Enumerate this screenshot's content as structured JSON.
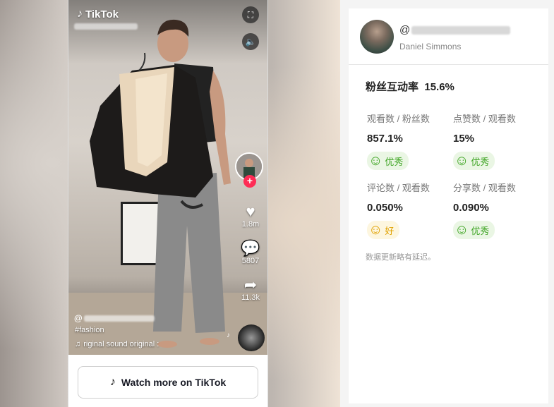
{
  "tiktok": {
    "brand": "TikTok",
    "likes": "1.8m",
    "comments": "5807",
    "shares": "11.3k",
    "handle_prefix": "@",
    "hashtag": "#fashion",
    "sound": "riginal sound   original :",
    "watch_button": "Watch more on TikTok"
  },
  "panel": {
    "at_prefix": "@",
    "name": "Daniel Simmons",
    "engagement_label": "粉丝互动率",
    "engagement_value": "15.6%",
    "metrics": [
      {
        "label": "观看数 / 粉丝数",
        "value": "857.1%",
        "rating": "优秀"
      },
      {
        "label": "点赞数 / 观看数",
        "value": "15%",
        "rating": "优秀"
      },
      {
        "label": "评论数 / 观看数",
        "value": "0.050%",
        "rating": "好"
      },
      {
        "label": "分享数 / 观看数",
        "value": "0.090%",
        "rating": "优秀"
      }
    ],
    "note": "数据更新略有延迟。"
  },
  "colors": {
    "good": "#3fa524",
    "ok": "#e0a100",
    "tiktok_red": "#fe2c55"
  },
  "icons": {
    "fullscreen": "fullscreen-icon",
    "volume": "volume-icon",
    "heart": "heart-icon",
    "comment": "comment-icon",
    "share": "share-icon",
    "music": "music-note-icon",
    "smile": "smile-face-icon"
  }
}
